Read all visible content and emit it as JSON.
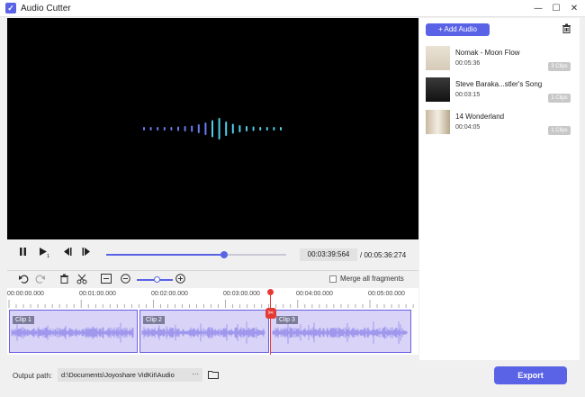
{
  "window": {
    "title": "Audio Cutter",
    "minimize_glyph": "—",
    "maximize_glyph": "☐",
    "close_glyph": "✕"
  },
  "library": {
    "add_label": "+ Add Audio",
    "items": [
      {
        "title": "Nomak - Moon Flow",
        "duration": "00:05:36",
        "clips": "3 Clips"
      },
      {
        "title": "Steve Baraka...stler's Song",
        "duration": "00:03:15",
        "clips": "1 Clips"
      },
      {
        "title": "14 Wonderland",
        "duration": "00:04:05",
        "clips": "1 Clips"
      }
    ]
  },
  "player": {
    "current_time": "00:03:39:564",
    "total_time": "/ 00:05:36:274",
    "progress": 0.655
  },
  "toolbar": {
    "merge_label": "Merge all fragments",
    "zoom_level": 0.55
  },
  "timeline": {
    "ticks": [
      "00:00:00.000",
      "00:01:00.000",
      "00:02:00.000",
      "00:03:00.000",
      "00:04:00.000",
      "00:05:00.000"
    ],
    "clips": [
      {
        "label": "Clip 1"
      },
      {
        "label": "Clip 2"
      },
      {
        "label": "Clip 3"
      }
    ]
  },
  "footer": {
    "output_label": "Output path:",
    "output_path": "d:\\Documents\\Joyoshare VidKit\\Audio",
    "more_label": "···",
    "export_label": "Export"
  },
  "colors": {
    "accent": "#5a63e6",
    "playhead": "#e53935",
    "clip_fill": "#d9d4f7"
  }
}
